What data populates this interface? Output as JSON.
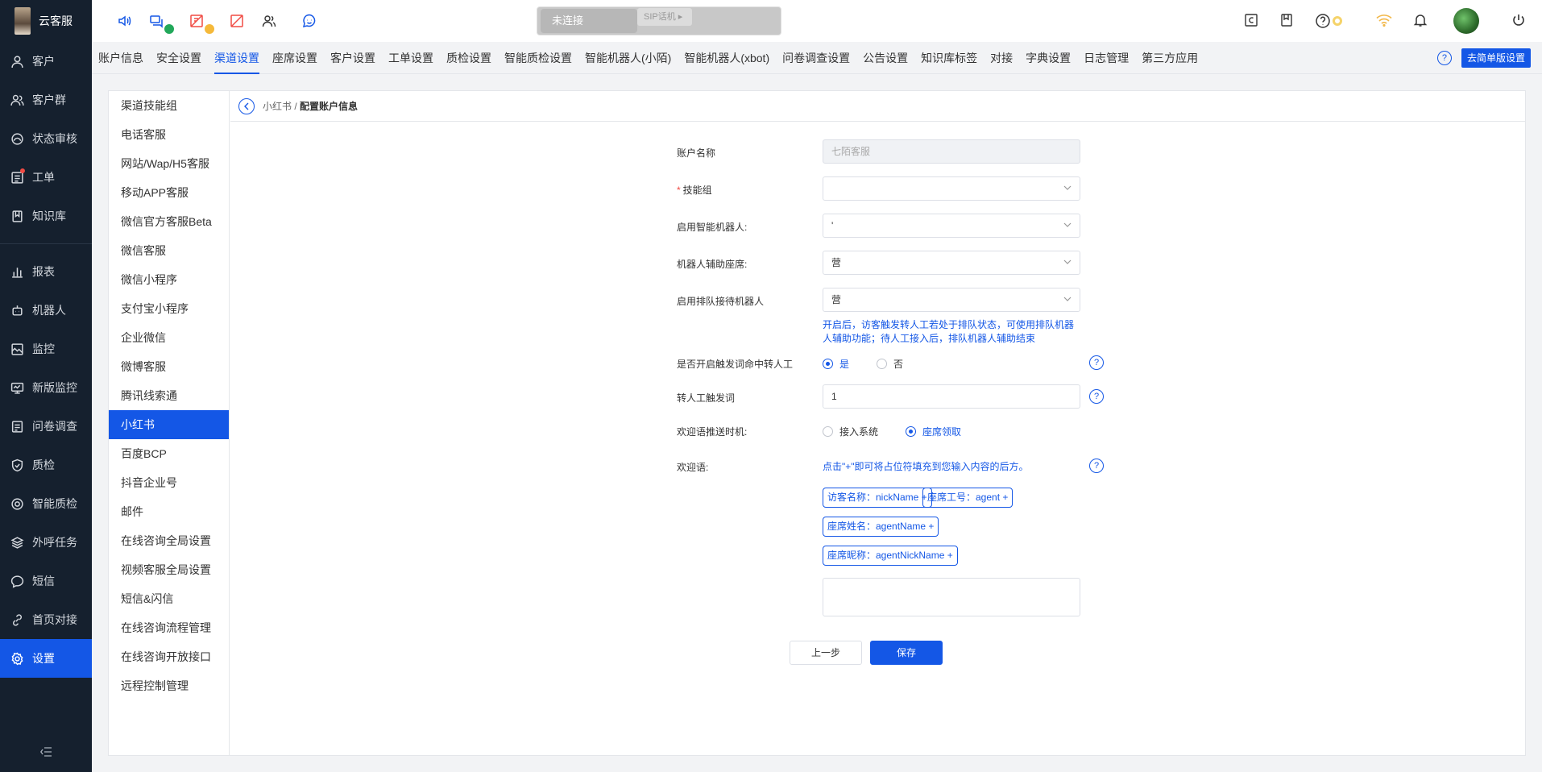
{
  "app": {
    "name": "云客服"
  },
  "sidebar": {
    "items": [
      {
        "label": "客户",
        "icon": "user-icon"
      },
      {
        "label": "客户群",
        "icon": "group-icon"
      },
      {
        "label": "状态审核",
        "icon": "audit-icon"
      },
      {
        "label": "工单",
        "icon": "ticket-icon"
      },
      {
        "label": "知识库",
        "icon": "book-icon"
      },
      {
        "label": "报表",
        "icon": "chart-icon"
      },
      {
        "label": "机器人",
        "icon": "robot-icon"
      },
      {
        "label": "监控",
        "icon": "monitor-icon"
      },
      {
        "label": "新版监控",
        "icon": "screen-icon"
      },
      {
        "label": "问卷调查",
        "icon": "survey-icon"
      },
      {
        "label": "质检",
        "icon": "shield-icon"
      },
      {
        "label": "智能质检",
        "icon": "smart-qc-icon"
      },
      {
        "label": "外呼任务",
        "icon": "layers-icon"
      },
      {
        "label": "短信",
        "icon": "message-icon"
      },
      {
        "label": "首页对接",
        "icon": "link-icon"
      },
      {
        "label": "设置",
        "icon": "gear-icon"
      }
    ]
  },
  "phone": {
    "status": "未连接",
    "sip": "SIP话机"
  },
  "tabs": {
    "items": [
      "账户信息",
      "安全设置",
      "渠道设置",
      "座席设置",
      "客户设置",
      "工单设置",
      "质检设置",
      "智能质检设置",
      "智能机器人(小陌)",
      "智能机器人(xbot)",
      "问卷调查设置",
      "公告设置",
      "知识库标签",
      "对接",
      "字典设置",
      "日志管理",
      "第三方应用"
    ],
    "simple_btn": "去简单版设置"
  },
  "submenu": {
    "items": [
      "渠道技能组",
      "电话客服",
      "网站/Wap/H5客服",
      "移动APP客服",
      "微信官方客服Beta",
      "微信客服",
      "微信小程序",
      "支付宝小程序",
      "企业微信",
      "微博客服",
      "腾讯线索通",
      "小红书",
      "百度BCP",
      "抖音企业号",
      "邮件",
      "在线咨询全局设置",
      "视频客服全局设置",
      "短信&闪信",
      "在线咨询流程管理",
      "在线咨询开放接口",
      "远程控制管理"
    ]
  },
  "breadcrumb": {
    "parent": "小红书",
    "sep": "/",
    "current": "配置账户信息"
  },
  "form": {
    "account_name_label": "账户名称",
    "account_name_value": "七陌客服",
    "skill_group_label": "技能组",
    "robot_label": "启用智能机器人:",
    "robot_value": "'",
    "assist_label": "机器人辅助座席:",
    "assist_value": "营",
    "queue_label": "启用排队接待机器人",
    "queue_value": "营",
    "queue_hint": "开启后，访客触发转人工若处于排队状态，可使用排队机器人辅助功能；待人工接入后，排队机器人辅助结束",
    "trigger_label": "是否开启触发词命中转人工",
    "trigger_yes": "是",
    "trigger_no": "否",
    "keyword_label": "转人工触发词",
    "keyword_value": "1",
    "welcome_time_label": "欢迎语推送时机:",
    "welcome_time_opt1": "接入系统",
    "welcome_time_opt2": "座席领取",
    "welcome_label": "欢迎语:",
    "welcome_hint": "点击\"+\"即可将占位符填充到您输入内容的后方。",
    "tags": [
      "访客名称：nickName +",
      "座席工号：agent +",
      "座席姓名：agentName +",
      "座席昵称：agentNickName +"
    ],
    "prev_btn": "上一步",
    "save_btn": "保存"
  }
}
